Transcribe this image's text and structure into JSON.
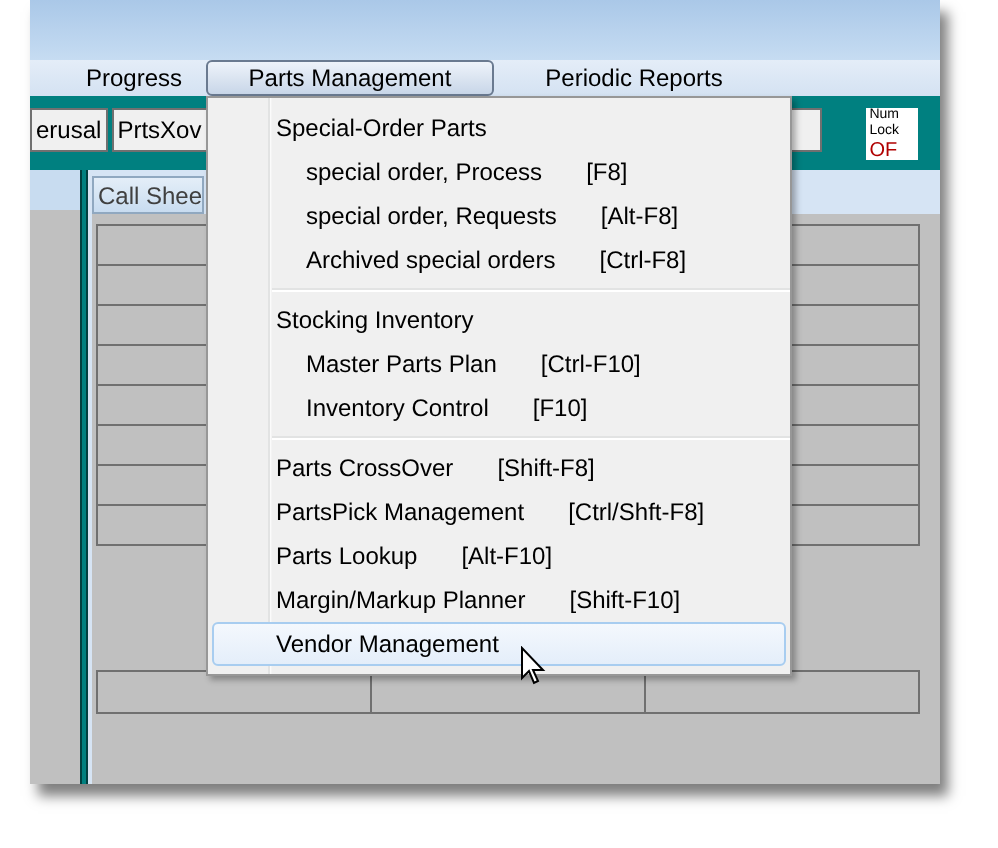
{
  "menu_bar": [
    {
      "label": "Progress",
      "selected": false
    },
    {
      "label": "Parts Management",
      "selected": true
    },
    {
      "label": "Periodic Reports",
      "selected": false
    }
  ],
  "toolbar": {
    "buttons": [
      "erusal",
      "PrtsXov"
    ],
    "num_lock": {
      "label_1": "Num",
      "label_2": "Lock",
      "state": "OF"
    }
  },
  "tab": {
    "label": "Call Shee"
  },
  "dropdown": {
    "sections": [
      {
        "items": [
          {
            "label": "Special-Order Parts",
            "selected": false,
            "children": [
              {
                "label": "special order, Process",
                "shortcut": "[F8]",
                "selected": false
              },
              {
                "label": "special order, Requests",
                "shortcut": "[Alt-F8]",
                "selected": false
              },
              {
                "label": "Archived special orders",
                "shortcut": "[Ctrl-F8]",
                "selected": false
              }
            ]
          }
        ]
      },
      {
        "items": [
          {
            "label": "Stocking Inventory",
            "selected": false,
            "children": [
              {
                "label": "Master Parts Plan",
                "shortcut": "[Ctrl-F10]",
                "selected": false
              },
              {
                "label": "Inventory Control",
                "shortcut": "[F10]",
                "selected": false
              }
            ]
          }
        ]
      },
      {
        "items": [
          {
            "label": "Parts CrossOver",
            "shortcut": "[Shift-F8]",
            "selected": false
          },
          {
            "label": "PartsPick Management",
            "shortcut": "[Ctrl/Shft-F8]",
            "selected": false
          },
          {
            "label": "Parts Lookup",
            "shortcut": "[Alt-F10]",
            "selected": false
          },
          {
            "label": "Margin/Markup Planner",
            "shortcut": "[Shift-F10]",
            "selected": false
          },
          {
            "label": "Vendor Management",
            "selected": true
          }
        ]
      }
    ]
  }
}
